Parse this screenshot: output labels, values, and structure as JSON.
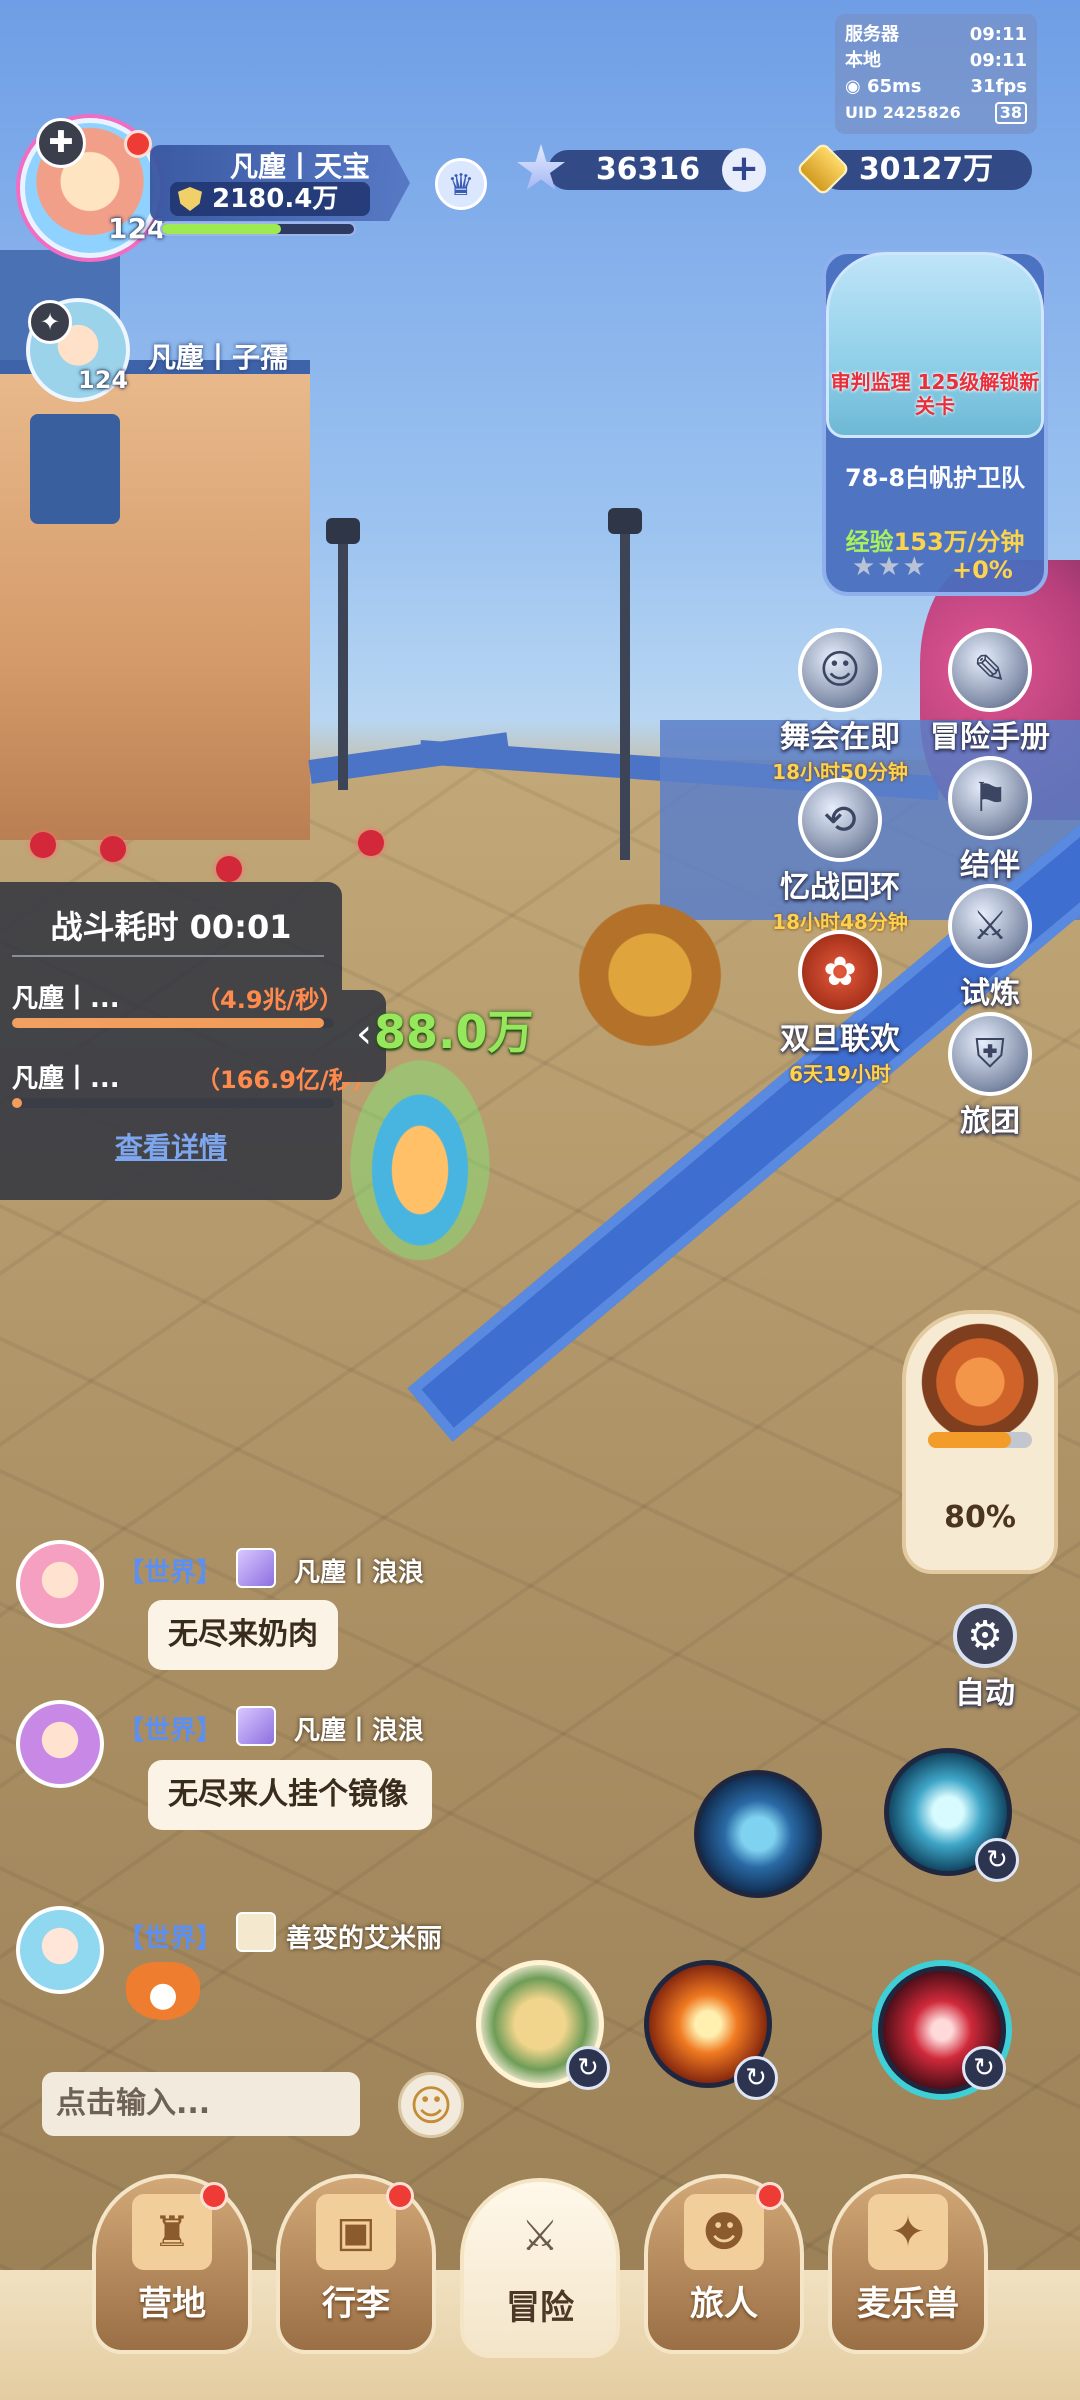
{
  "status": {
    "server_label": "服务器",
    "server_time": "09:11",
    "local_label": "本地",
    "local_time": "09:11",
    "ping": "65ms",
    "fps": "31fps",
    "uid": "UID 2425826",
    "battery": "38"
  },
  "player": {
    "name": "凡塵丨天宝",
    "power": "2180.4万",
    "level": "124",
    "exp_fraction": 0.62
  },
  "teammate": {
    "name": "凡塵丨子孺",
    "level": "124"
  },
  "resources": {
    "stars": "36316",
    "gold": "30127万"
  },
  "stage": {
    "unlock_text": "审判监理 125级解锁新关卡",
    "name": "78-8白帆护卫队",
    "exp_label": "经验",
    "exp_rate": "153万/分钟",
    "stars_filled": 0,
    "stars_total": 3,
    "bonus": "+0%"
  },
  "side_menu": {
    "items": [
      {
        "label": "舞会在即",
        "timer": "18小时50分钟"
      },
      {
        "label": "冒险手册",
        "timer": ""
      },
      {
        "label": "忆战回环",
        "timer": "18小时48分钟"
      },
      {
        "label": "结伴",
        "timer": ""
      },
      {
        "label": "双旦联欢",
        "timer": "6天19小时"
      },
      {
        "label": "试炼",
        "timer": ""
      },
      {
        "label": "旅团",
        "timer": ""
      }
    ]
  },
  "battle": {
    "title": "战斗耗时 00:01",
    "rows": [
      {
        "name": "凡塵丨...",
        "rate": "（4.9兆/秒）",
        "fraction": 0.97
      },
      {
        "name": "凡塵丨...",
        "rate": "（166.9亿/秒）",
        "fraction": 0.03
      }
    ],
    "detail_link": "查看详情",
    "floating_damage": "88.0万"
  },
  "pet": {
    "percent_text": "80%",
    "fraction": 0.8
  },
  "auto_label": "自动",
  "chat": {
    "messages": [
      {
        "channel": "【世界】",
        "sender": "凡塵丨浪浪",
        "text": "无尽来奶肉"
      },
      {
        "channel": "【世界】",
        "sender": "凡塵丨浪浪",
        "text": "无尽来人挂个镜像"
      },
      {
        "channel": "【世界】",
        "sender": "善变的艾米丽",
        "text": ""
      }
    ],
    "input_placeholder": "点击输入..."
  },
  "nav": {
    "tabs": [
      {
        "label": "营地",
        "badge": true
      },
      {
        "label": "行李",
        "badge": true
      },
      {
        "label": "冒险",
        "badge": false,
        "active": true
      },
      {
        "label": "旅人",
        "badge": true
      },
      {
        "label": "麦乐兽",
        "badge": false
      }
    ]
  },
  "colors": {
    "accent_green": "#95e85c",
    "rate_orange": "#ff8a4c",
    "link_blue": "#7ea6ef",
    "timer_yellow": "#fcd24e"
  }
}
